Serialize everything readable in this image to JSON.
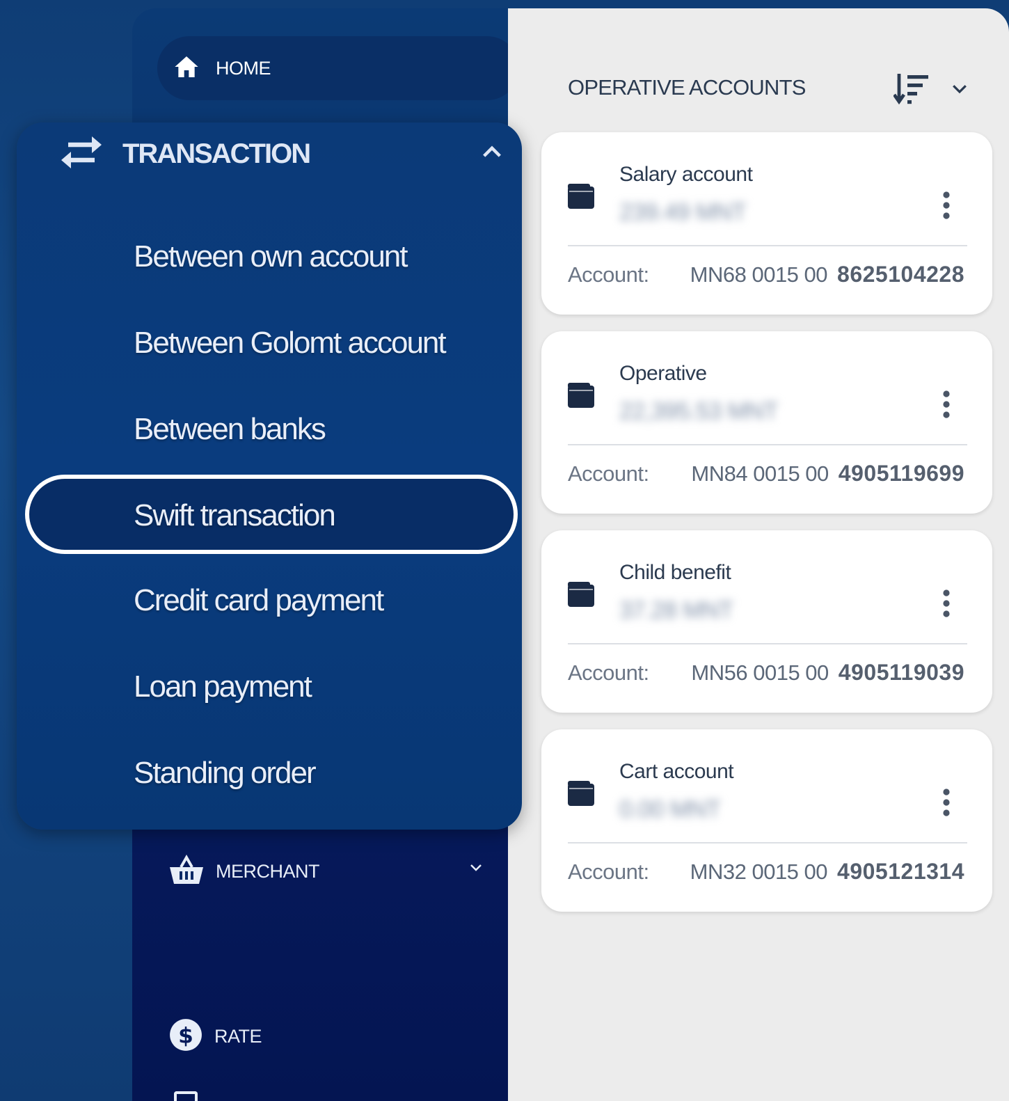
{
  "sidebar": {
    "home_label": "HOME",
    "merchant_label": "MERCHANT",
    "rate_label": "RATE"
  },
  "transaction_menu": {
    "title": "TRANSACTION",
    "items": [
      "Between own account",
      "Between Golomt account",
      "Between banks",
      "Swift transaction",
      "Credit card payment",
      "Loan payment",
      "Standing order"
    ],
    "selected_index": 3
  },
  "accounts": {
    "section_title": "OPERATIVE ACCOUNTS",
    "account_label": "Account:",
    "items": [
      {
        "name": "Salary account",
        "balance": "239.49 MNT",
        "iban_prefix": "MN68 0015 00",
        "number": "8625104228"
      },
      {
        "name": "Operative",
        "balance": "22,395.53 MNT",
        "iban_prefix": "MN84 0015 00",
        "number": "4905119699"
      },
      {
        "name": "Child benefit",
        "balance": "37.28 MNT",
        "iban_prefix": "MN56 0015 00",
        "number": "4905119039"
      },
      {
        "name": "Cart account",
        "balance": "0.00 MNT",
        "iban_prefix": "MN32 0015 00",
        "number": "4905121314"
      }
    ]
  },
  "colors": {
    "accent": "#0a3c7e",
    "sidebar_dark": "#041552",
    "content_bg": "#ececec"
  },
  "icons": {
    "home": "home-icon",
    "transaction": "swap-arrows-icon",
    "merchant": "basket-icon",
    "rate": "dollar-circle-icon",
    "wallet": "wallet-icon",
    "sort": "sort-icon",
    "menu": "kebab-icon"
  }
}
